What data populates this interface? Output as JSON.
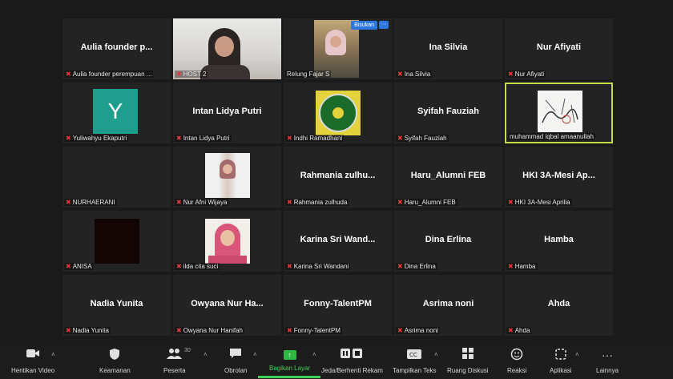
{
  "participants": [
    {
      "name": "Aulia founder p...",
      "label": "Aulia founder perempuan ...",
      "type": "name"
    },
    {
      "name": "",
      "label": "HOST 2",
      "type": "video-host"
    },
    {
      "name": "",
      "label": "Relung Fajar S",
      "type": "video-relung",
      "badge": "Bisukan",
      "more": "···"
    },
    {
      "name": "Ina Silvia",
      "label": "Ina Silvia",
      "type": "name"
    },
    {
      "name": "Nur Afiyati",
      "label": "Nur Afiyati",
      "type": "name"
    },
    {
      "name": "",
      "label": "Yuliwahyu Ekaputri",
      "type": "avatar",
      "avatar_letter": "Y"
    },
    {
      "name": "Intan Lidya Putri",
      "label": "Intan Lidya Putri",
      "type": "name"
    },
    {
      "name": "",
      "label": "Indhi Ramadhani",
      "type": "logo"
    },
    {
      "name": "Syifah Fauziah",
      "label": "Syifah Fauziah",
      "type": "name"
    },
    {
      "name": "",
      "label": "muhammad iqbal amaanullah",
      "type": "sketch",
      "active": true
    },
    {
      "name": "",
      "label": "NURHAERANI",
      "type": "blank"
    },
    {
      "name": "",
      "label": "Nur Afni Wijaya",
      "type": "photo-afni"
    },
    {
      "name": "Rahmania zulhu...",
      "label": "Rahmania zulhuda",
      "type": "name"
    },
    {
      "name": "Haru_Alumni FEB",
      "label": "Haru_Alumni FEB",
      "type": "name"
    },
    {
      "name": "HKI 3A-Mesi Ap...",
      "label": "HKI 3A-Mesi Aprilia",
      "type": "name"
    },
    {
      "name": "",
      "label": "ANISA",
      "type": "dark-photo"
    },
    {
      "name": "",
      "label": "ilda cita suci",
      "type": "photo-ilda"
    },
    {
      "name": "Karina Sri Wand...",
      "label": "Karina Sri Wandani",
      "type": "name"
    },
    {
      "name": "Dina Erlina",
      "label": "Dina Erlina",
      "type": "name"
    },
    {
      "name": "Hamba",
      "label": "Hamba",
      "type": "name"
    },
    {
      "name": "Nadia Yunita",
      "label": "Nadia Yunita",
      "type": "name"
    },
    {
      "name": "Owyana Nur Ha...",
      "label": "Owyana Nur Hanifah",
      "type": "name"
    },
    {
      "name": "Fonny-TalentPM",
      "label": "Fonny-TalentPM",
      "type": "name"
    },
    {
      "name": "Asrima noni",
      "label": "Asrima noni",
      "type": "name"
    },
    {
      "name": "Ahda",
      "label": "Ahda",
      "type": "name"
    }
  ],
  "toolbar": {
    "items": [
      {
        "label": "Hentikan Video",
        "icon": "video-camera-icon",
        "glyph": "■"
      },
      {
        "label": "Keamanan",
        "icon": "shield-icon",
        "glyph": "⛨"
      },
      {
        "label": "Peserta",
        "icon": "participants-icon",
        "glyph": "☻",
        "count": "30"
      },
      {
        "label": "Obrolan",
        "icon": "chat-icon",
        "glyph": "▬"
      },
      {
        "label": "Bagikan Layar",
        "icon": "share-screen-icon",
        "glyph": "↑"
      },
      {
        "label": "Jeda/Berhenti Rekam",
        "icon": "pause-record-icon",
        "glyph": "⏸"
      },
      {
        "label": "Tampilkan Teks",
        "icon": "captions-icon",
        "glyph": "CC"
      },
      {
        "label": "Ruang Diskusi",
        "icon": "breakout-rooms-icon",
        "glyph": "▦"
      },
      {
        "label": "Reaksi",
        "icon": "reaction-icon",
        "glyph": "☺"
      },
      {
        "label": "Aplikasi",
        "icon": "apps-icon",
        "glyph": "⬚"
      },
      {
        "label": "Lainnya",
        "icon": "more-icon",
        "glyph": "···"
      }
    ]
  },
  "colors": {
    "accent": "#3ecf55",
    "active_speaker": "#c7d94a",
    "muted": "#e03b3b"
  }
}
